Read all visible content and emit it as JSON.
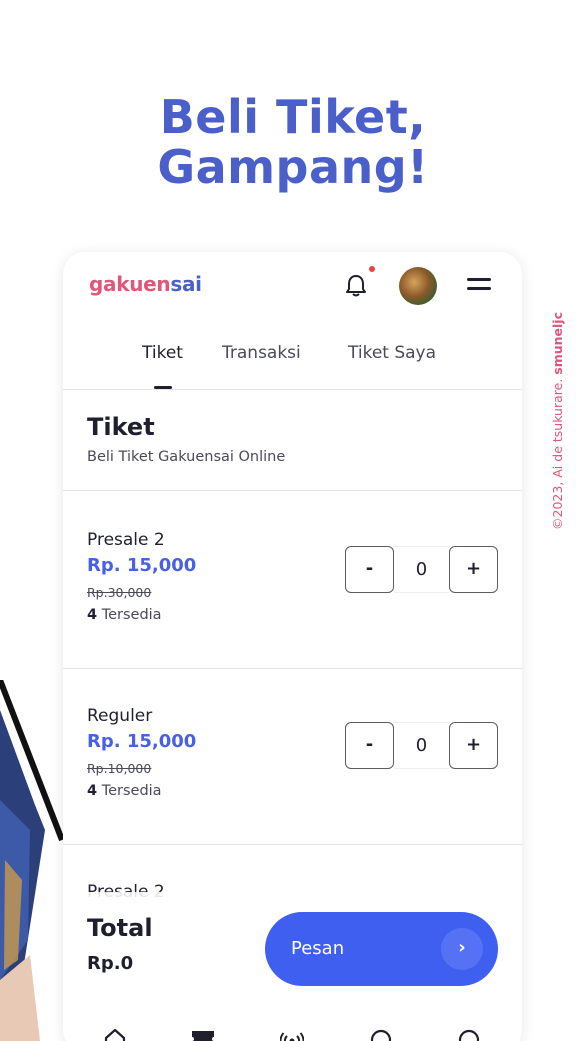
{
  "headline": {
    "line1": "Beli Tiket,",
    "line2": "Gampang!"
  },
  "credit": {
    "prefix": "©2023, Ai de tsukurare. ",
    "author": "smuneljc"
  },
  "app": {
    "logo_part1": "gakuen",
    "logo_part2": "sai",
    "tabs": [
      {
        "label": "Tiket",
        "active": true
      },
      {
        "label": "Transaksi",
        "active": false
      },
      {
        "label": "Tiket Saya",
        "active": false
      }
    ]
  },
  "section": {
    "title": "Tiket",
    "subtitle": "Beli Tiket Gakuensai Online"
  },
  "tickets": [
    {
      "name": "Presale 2",
      "price": "Rp. 15,000",
      "old_price": "Rp.30,000",
      "stock_count": "4",
      "stock_label": " Tersedia",
      "minus": "-",
      "qty": "0",
      "plus": "+"
    },
    {
      "name": "Reguler",
      "price": "Rp. 15,000",
      "old_price": "Rp.10,000",
      "stock_count": "4",
      "stock_label": " Tersedia",
      "minus": "-",
      "qty": "0",
      "plus": "+"
    }
  ],
  "partial_ticket_name": "Presale 2",
  "footer": {
    "total_label": "Total",
    "total_value": "Rp.0",
    "order_label": "Pesan",
    "order_arrow": "›"
  },
  "bottom_nav": [
    "home-icon",
    "ticket-icon",
    "broadcast-icon",
    "circle-icon",
    "profile-icon"
  ],
  "colors": {
    "brand_blue": "#4a5fc9",
    "accent_pink": "#e0567a",
    "button_blue": "#3f5ff0",
    "price_blue": "#4a5fe8"
  }
}
